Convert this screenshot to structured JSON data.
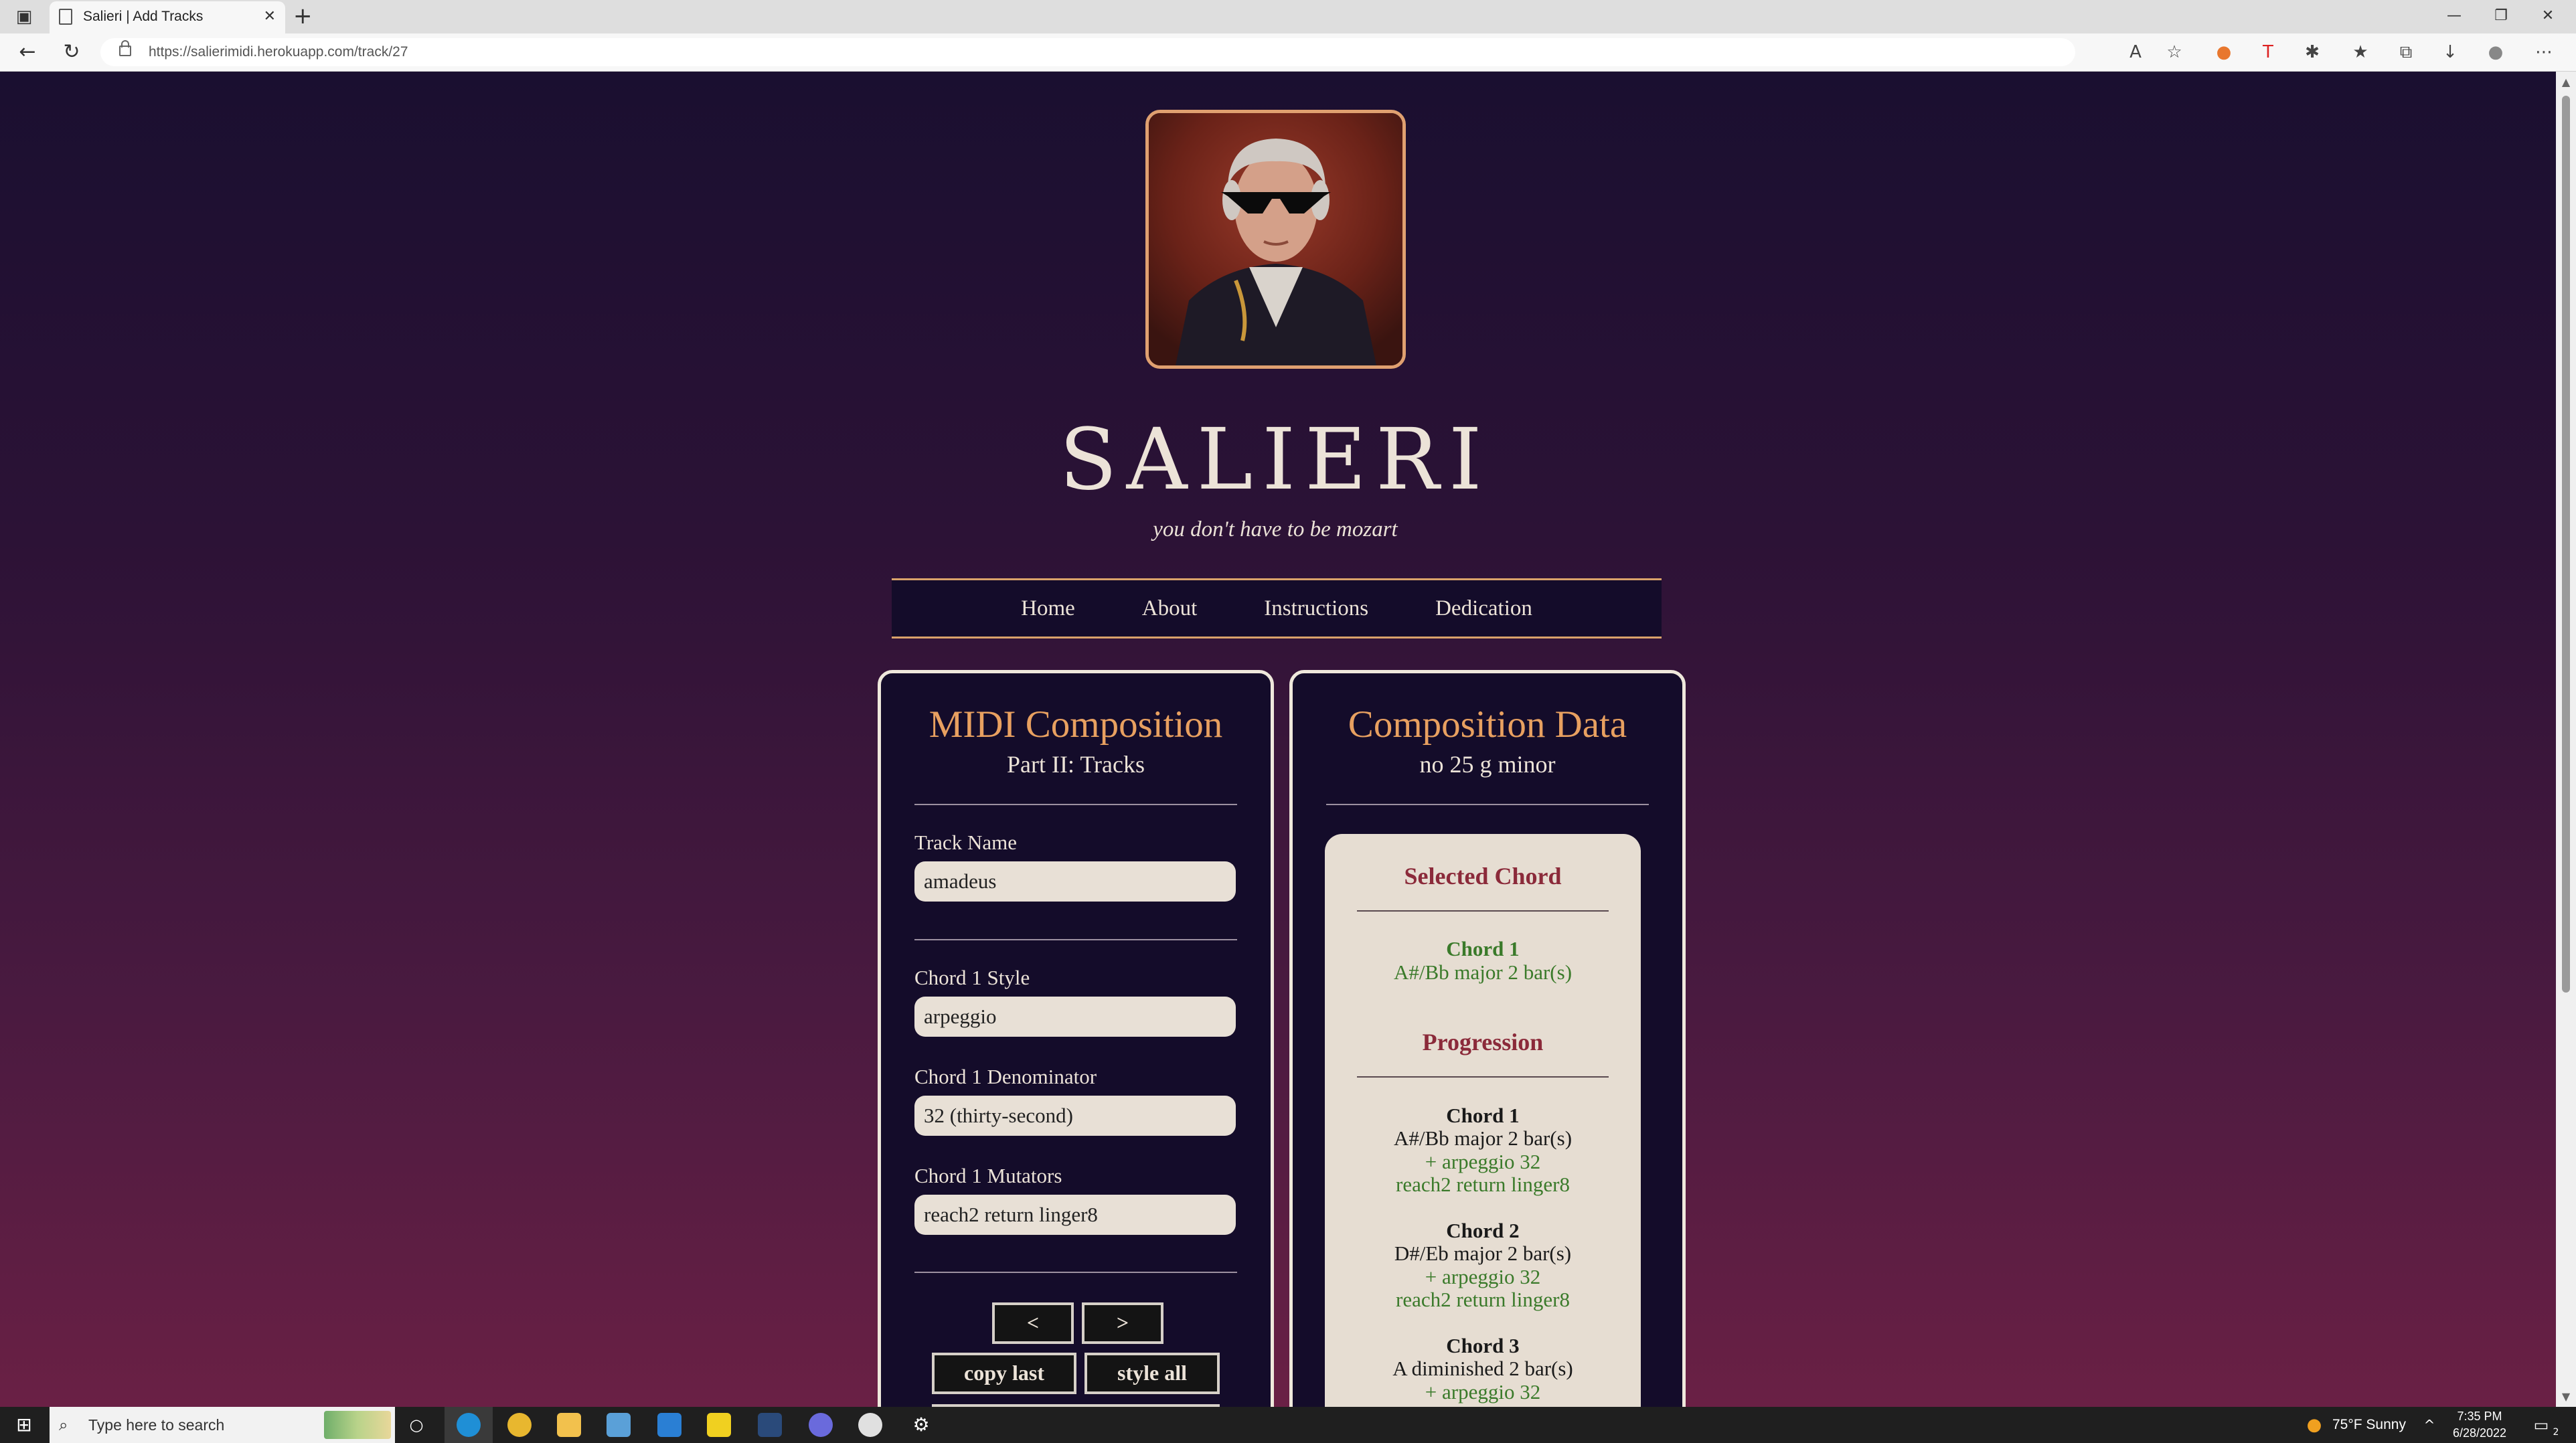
{
  "browser": {
    "tab_title": "Salieri | Add Tracks",
    "tab_close": "✕",
    "new_tab": "+",
    "url": "https://salierimidi.herokuapp.com/track/27",
    "window_controls": {
      "minimize": "—",
      "restore": "❐",
      "close": "✕"
    }
  },
  "site": {
    "title": "SALIERI",
    "tagline": "you don't have to be mozart",
    "nav": [
      "Home",
      "About",
      "Instructions",
      "Dedication"
    ]
  },
  "composition": {
    "heading": "MIDI Composition",
    "subheading": "Part II: Tracks",
    "track_name_label": "Track Name",
    "track_name_value": "amadeus",
    "style_label": "Chord 1 Style",
    "style_value": "arpeggio",
    "denominator_label": "Chord 1 Denominator",
    "denominator_value": "32 (thirty-second)",
    "mutators_label": "Chord 1 Mutators",
    "mutators_value": "reach2 return linger8",
    "prev_button": "<",
    "next_button": ">",
    "copy_last_button": "copy last",
    "style_all_button": "style all"
  },
  "data_panel": {
    "heading": "Composition Data",
    "subheading": "no 25 g minor",
    "selected_heading": "Selected Chord",
    "selected_chord": {
      "name": "Chord 1",
      "detail": "A#/Bb major 2 bar(s)"
    },
    "progression_heading": "Progression",
    "progression": [
      {
        "name": "Chord 1",
        "detail": "A#/Bb major 2 bar(s)",
        "style": "+ arpeggio 32",
        "mutators": "reach2 return linger8"
      },
      {
        "name": "Chord 2",
        "detail": "D#/Eb major 2 bar(s)",
        "style": "+ arpeggio 32",
        "mutators": "reach2 return linger8"
      },
      {
        "name": "Chord 3",
        "detail": "A diminished 2 bar(s)",
        "style": "+ arpeggio 32",
        "mutators": ""
      }
    ]
  },
  "taskbar": {
    "search_placeholder": "Type here to search",
    "weather": "75°F  Sunny",
    "time": "7:35 PM",
    "date": "6/28/2022",
    "notification_count": "2"
  },
  "colors": {
    "accent_orange": "#e8a060",
    "cream": "#ece3d8",
    "panel_bg": "#140c2a",
    "chord_green": "#3a7a2a",
    "heading_maroon": "#8b2a3a"
  }
}
